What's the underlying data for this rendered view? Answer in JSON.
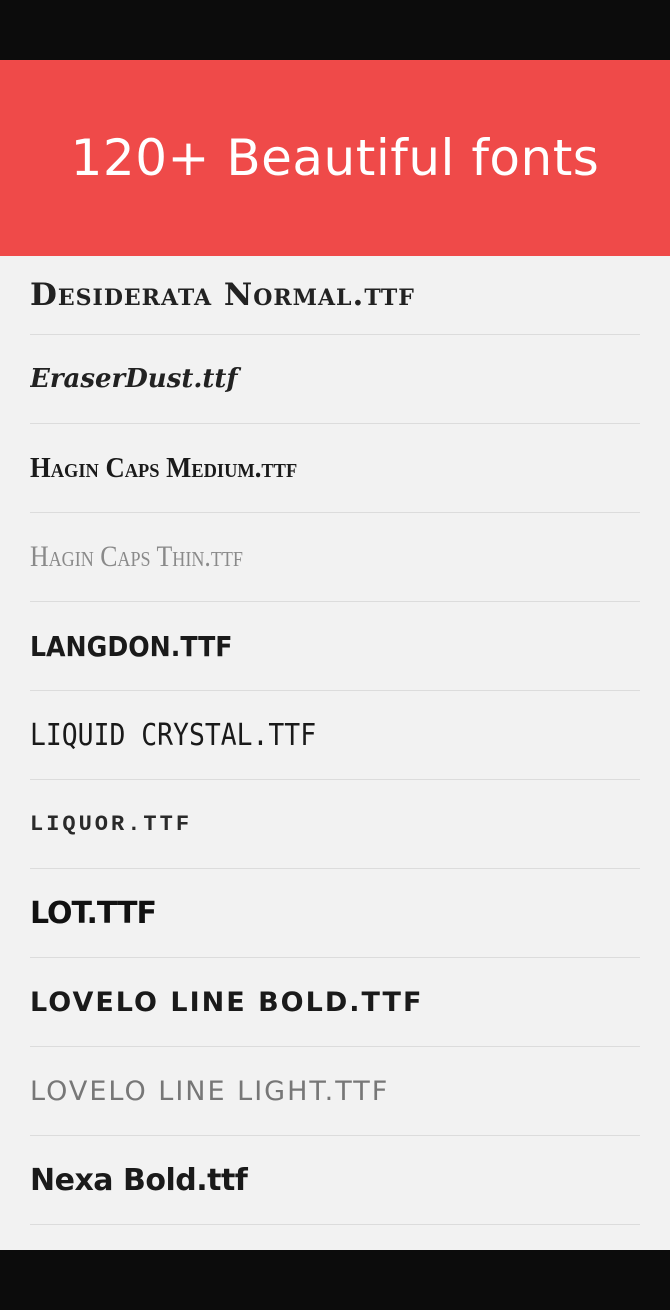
{
  "banner": {
    "title": "120+ Beautiful fonts"
  },
  "colors": {
    "banner_background": "#ef4a49",
    "list_background": "#f2f2f2",
    "system_bars": "#0c0c0c"
  },
  "font_list": {
    "items": [
      {
        "label": "Desiderata Normal.ttf"
      },
      {
        "label": "EraserDust.ttf"
      },
      {
        "label": "Hagin Caps Medium.ttf"
      },
      {
        "label": "Hagin Caps Thin.ttf"
      },
      {
        "label": "LANGDON.TTF"
      },
      {
        "label": "LIQUID CRYSTAL.TTF"
      },
      {
        "label": "LIQUOR.TTF"
      },
      {
        "label": "LOT.TTF"
      },
      {
        "label": "LOVELO LINE BOLD.TTF"
      },
      {
        "label": "LOVELO LINE LIGHT.TTF"
      },
      {
        "label": "Nexa Bold.ttf"
      }
    ]
  }
}
